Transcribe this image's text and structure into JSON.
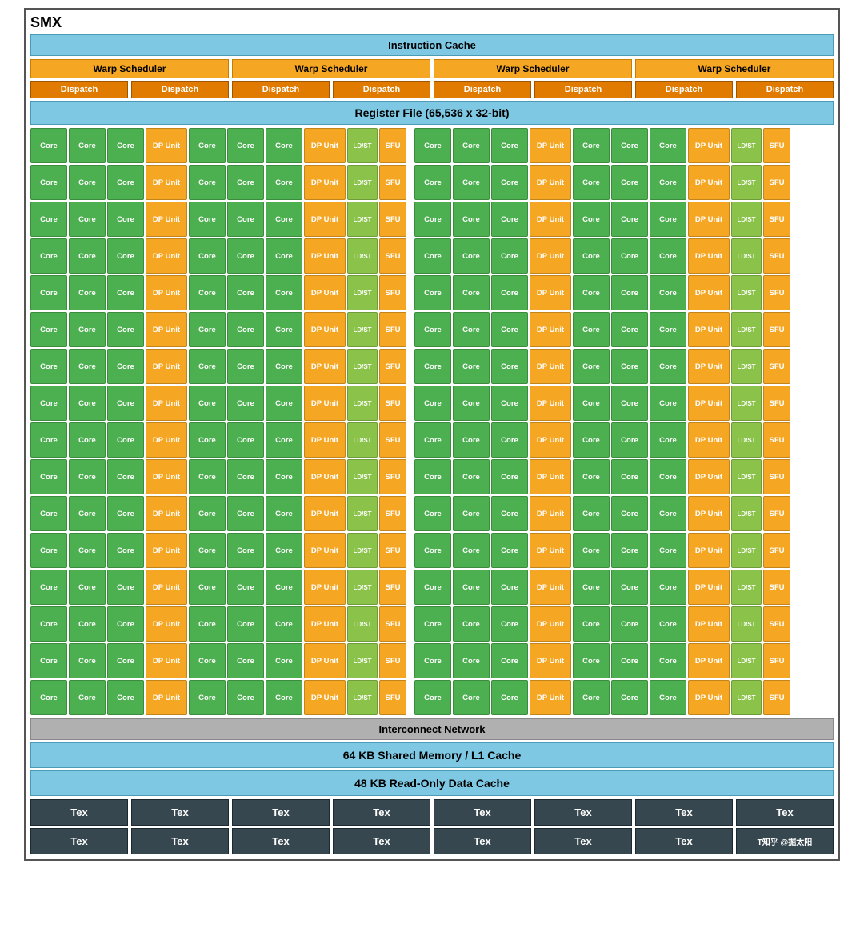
{
  "title": "SMX",
  "instruction_cache": "Instruction Cache",
  "warp_schedulers": [
    "Warp Scheduler",
    "Warp Scheduler",
    "Warp Scheduler",
    "Warp Scheduler"
  ],
  "dispatch_units": [
    "Dispatch",
    "Dispatch",
    "Dispatch",
    "Dispatch",
    "Dispatch",
    "Dispatch",
    "Dispatch",
    "Dispatch"
  ],
  "register_file": "Register File (65,536 x 32-bit)",
  "num_rows": 16,
  "interconnect": "Interconnect Network",
  "shared_memory": "64 KB Shared Memory / L1 Cache",
  "readonly_cache": "48 KB Read-Only Data Cache",
  "tex_rows": [
    [
      "Tex",
      "Tex",
      "Tex",
      "Tex",
      "Tex",
      "Tex",
      "Tex",
      "Tex"
    ],
    [
      "Tex",
      "Tex",
      "Tex",
      "Tex",
      "Tex",
      "Tex",
      "T知乎 @掘太阳"
    ]
  ],
  "labels": {
    "core": "Core",
    "dp_unit": "DP Unit",
    "ldst": "LD/ST",
    "sfu": "SFU"
  },
  "colors": {
    "core": "#4caf50",
    "dp": "#f5a623",
    "ldst": "#8bc34a",
    "sfu": "#f5a623",
    "warp": "#f5a623",
    "dispatch": "#e07b00",
    "cache": "#7ec8e3",
    "interconnect": "#b0b0b0",
    "tex": "#37474f"
  }
}
